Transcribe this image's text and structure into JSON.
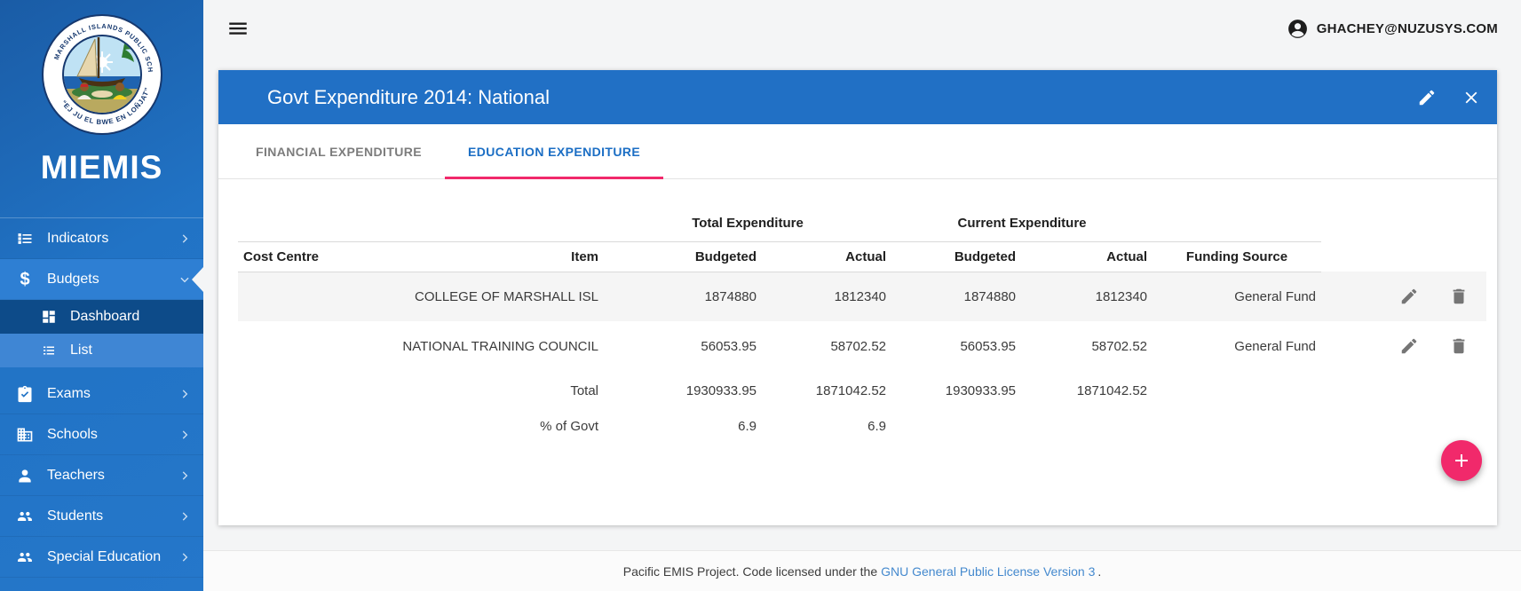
{
  "sidebar": {
    "brand": "MIEMIS",
    "seal": {
      "ring_top": "MARSHALL ISLANDS PUBLIC SCHOOL SYSTEM",
      "ring_bottom": "“EJ JU EL BWE EN LOÑJAT”"
    },
    "items": [
      {
        "label": "Indicators"
      },
      {
        "label": "Budgets"
      },
      {
        "label": "Dashboard"
      },
      {
        "label": "List"
      },
      {
        "label": "Exams"
      },
      {
        "label": "Schools"
      },
      {
        "label": "Teachers"
      },
      {
        "label": "Students"
      },
      {
        "label": "Special Education"
      }
    ]
  },
  "topbar": {
    "user_email": "GHACHEY@NUZUSYS.COM"
  },
  "card": {
    "title": "Govt Expenditure 2014: National",
    "tabs": [
      {
        "label": "FINANCIAL EXPENDITURE"
      },
      {
        "label": "EDUCATION EXPENDITURE"
      }
    ],
    "table": {
      "group": {
        "total": "Total Expenditure",
        "current": "Current Expenditure"
      },
      "columns": [
        "Cost Centre",
        "Item",
        "Budgeted",
        "Actual",
        "Budgeted",
        "Actual",
        "Funding Source"
      ],
      "rows": [
        {
          "cost_centre": "",
          "item": "COLLEGE OF MARSHALL ISL",
          "total_budgeted": "1874880",
          "total_actual": "1812340",
          "current_budgeted": "1874880",
          "current_actual": "1812340",
          "funding_source": "General Fund"
        },
        {
          "cost_centre": "",
          "item": "NATIONAL TRAINING COUNCIL",
          "total_budgeted": "56053.95",
          "total_actual": "58702.52",
          "current_budgeted": "56053.95",
          "current_actual": "58702.52",
          "funding_source": "General Fund"
        }
      ],
      "total_row": {
        "label": "Total",
        "total_budgeted": "1930933.95",
        "total_actual": "1871042.52",
        "current_budgeted": "1930933.95",
        "current_actual": "1871042.52"
      },
      "pct_row": {
        "label": "% of Govt",
        "total_budgeted": "6.9",
        "total_actual": "6.9"
      }
    }
  },
  "footer": {
    "text_before_link": "Pacific EMIS Project. Code licensed under the",
    "link_text": "GNU General Public License Version 3",
    "text_after_link": "."
  },
  "colors": {
    "sidebar_blue": "#2173c5",
    "submenu_dark_blue": "#0d4b89",
    "submenu_selected_blue": "#3f86d4",
    "card_header_blue": "#2170c5",
    "active_tab_blue": "#1b6ec4",
    "accent_pink": "#f1296b",
    "footer_link_blue": "#4489ce",
    "zebra_gray": "#f5f5f5",
    "background_gray": "#f4f5f6"
  }
}
